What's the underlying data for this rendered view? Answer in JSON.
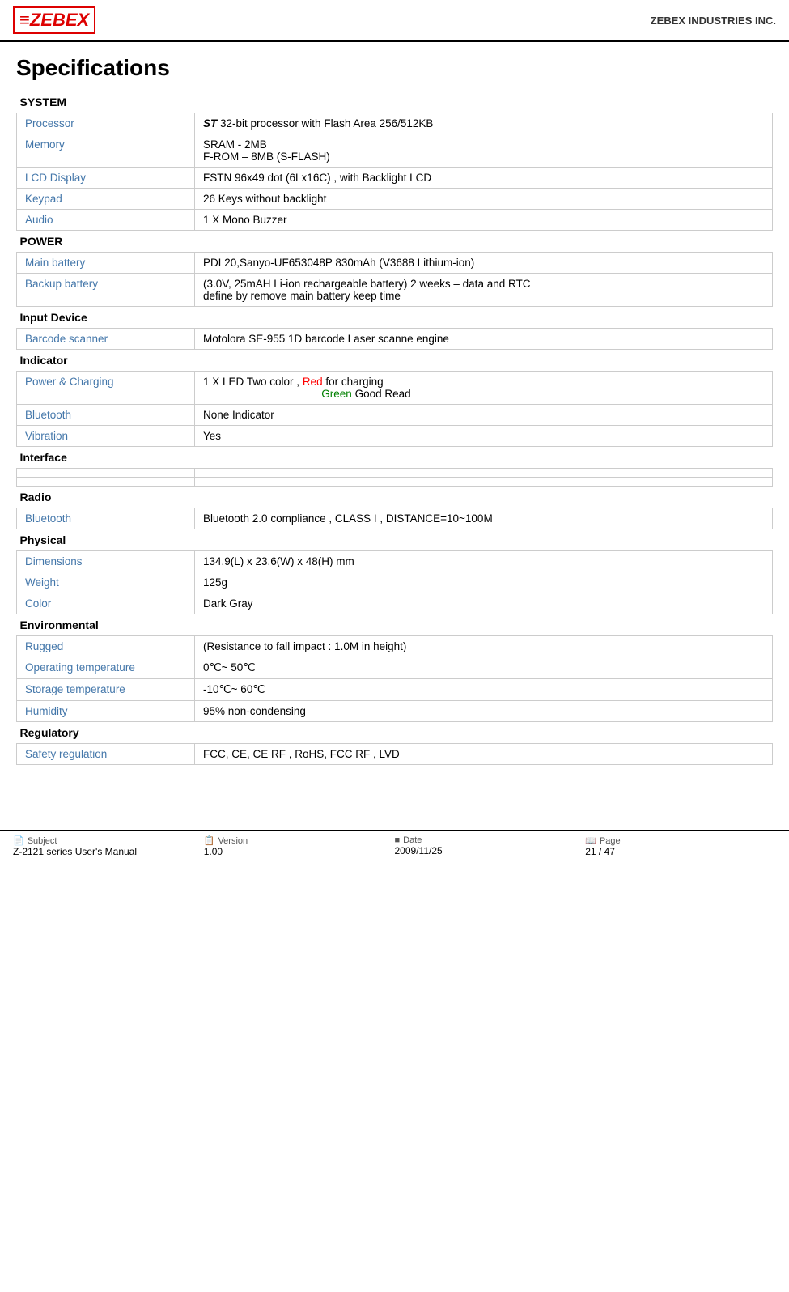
{
  "header": {
    "logo": "≡ZEBEX",
    "company": "ZEBEX INDUSTRIES INC."
  },
  "page_title": "Specifications",
  "sections": [
    {
      "name": "SYSTEM",
      "rows": [
        {
          "label": "Processor",
          "value": "ST 32-bit processor with Flash Area 256/512KB",
          "italic_bold_prefix": "ST"
        },
        {
          "label": "Memory",
          "value": "SRAM - 2MB\nF-ROM – 8MB (S-FLASH)"
        },
        {
          "label": "LCD Display",
          "value": "FSTN 96x49 dot (6Lx16C) , with Backlight LCD"
        },
        {
          "label": "Keypad",
          "value": "26 Keys without backlight"
        },
        {
          "label": "Audio",
          "value": "1 X Mono Buzzer"
        }
      ]
    },
    {
      "name": "POWER",
      "rows": [
        {
          "label": "Main battery",
          "value": "PDL20,Sanyo-UF653048P 830mAh (V3688 Lithium-ion)"
        },
        {
          "label": "Backup battery",
          "value": "(3.0V, 25mAH Li-ion rechargeable battery) 2 weeks – data and RTC\ndefine by remove main battery keep time"
        }
      ]
    },
    {
      "name": "Input Device",
      "rows": [
        {
          "label": "Barcode scanner",
          "value": "Motolora SE-955 1D barcode Laser scanne engine"
        }
      ]
    },
    {
      "name": "Indicator",
      "rows": [
        {
          "label": "Power & Charging",
          "value_html": "1 X LED Two color , <span class=\"red\">Red</span> for charging<br>&nbsp;&nbsp;&nbsp;&nbsp;&nbsp;&nbsp;&nbsp;&nbsp;&nbsp;&nbsp;&nbsp;&nbsp;&nbsp;&nbsp;&nbsp;&nbsp;&nbsp;&nbsp;&nbsp;&nbsp;&nbsp;&nbsp;&nbsp;&nbsp;&nbsp;&nbsp;&nbsp;&nbsp;&nbsp;&nbsp;&nbsp;&nbsp;&nbsp;&nbsp;&nbsp;&nbsp;&nbsp;&nbsp;&nbsp;<span class=\"green\">Green</span> Good Read"
        },
        {
          "label": "Bluetooth",
          "value": "None Indicator"
        },
        {
          "label": "Vibration",
          "value": "Yes"
        }
      ]
    },
    {
      "name": "Interface",
      "rows": [
        {
          "label": "",
          "value": ""
        },
        {
          "label": "",
          "value": ""
        }
      ]
    },
    {
      "name": "Radio",
      "rows": [
        {
          "label": "Bluetooth",
          "value": "Bluetooth 2.0 compliance , CLASS I , DISTANCE=10~100M"
        }
      ]
    },
    {
      "name": "Physical",
      "rows": [
        {
          "label": "Dimensions",
          "value": "134.9(L) x 23.6(W) x 48(H) mm"
        },
        {
          "label": "Weight",
          "value": "125g"
        },
        {
          "label": "Color",
          "value": "Dark Gray"
        }
      ]
    },
    {
      "name": "Environmental",
      "rows": [
        {
          "label": "Rugged",
          "value": "(Resistance to fall impact : 1.0M in height)"
        },
        {
          "label": "Operating temperature",
          "value": "0℃~ 50℃"
        },
        {
          "label": "Storage temperature",
          "value": "-10℃~ 60℃"
        },
        {
          "label": "Humidity",
          "value": "95% non-condensing"
        }
      ]
    },
    {
      "name": "Regulatory",
      "rows": [
        {
          "label": "Safety regulation",
          "value": "FCC, CE, CE RF , RoHS, FCC RF , LVD"
        }
      ]
    }
  ],
  "footer": {
    "subject_label": "Subject",
    "subject_value": "Z-2121 series User's Manual",
    "version_label": "Version",
    "version_value": "1.00",
    "date_label": "Date",
    "date_value": "2009/11/25",
    "page_label": "Page",
    "page_value": "21 / 47"
  }
}
